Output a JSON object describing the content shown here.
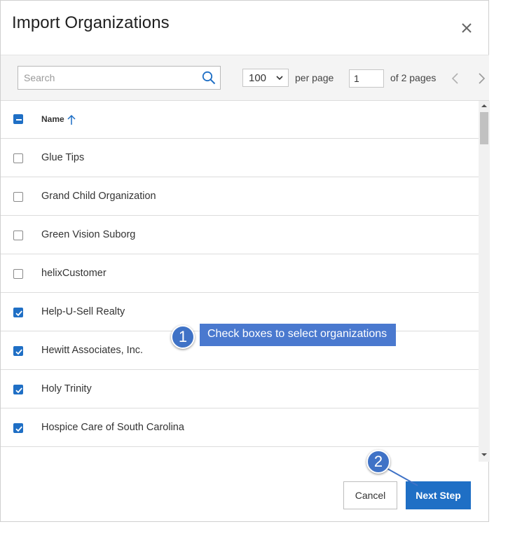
{
  "dialog": {
    "title": "Import Organizations"
  },
  "toolbar": {
    "search_placeholder": "Search",
    "per_page_value": "100",
    "per_page_label": "per page",
    "page_number": "1",
    "of_pages": "of 2 pages"
  },
  "table": {
    "header_name": "Name",
    "header_checkbox_state": "indeterminate",
    "rows": [
      {
        "name": "Glue Tips",
        "checked": false
      },
      {
        "name": "Grand Child Organization",
        "checked": false
      },
      {
        "name": "Green Vision Suborg",
        "checked": false
      },
      {
        "name": "helixCustomer",
        "checked": false
      },
      {
        "name": "Help-U-Sell Realty",
        "checked": true
      },
      {
        "name": "Hewitt Associates, Inc.",
        "checked": true
      },
      {
        "name": "Holy Trinity",
        "checked": true
      },
      {
        "name": "Hospice Care of South Carolina",
        "checked": true
      }
    ]
  },
  "footer": {
    "cancel_label": "Cancel",
    "next_label": "Next Step"
  },
  "callouts": {
    "one_number": "1",
    "one_text": "Check boxes to select organizations",
    "two_number": "2"
  },
  "colors": {
    "accent": "#1f6fc5",
    "callout": "#4a79cf"
  },
  "icons": [
    "close-icon",
    "search-icon",
    "chevron-down-icon",
    "chevron-left-icon",
    "chevron-right-icon",
    "arrow-up-icon",
    "checkmark-icon"
  ]
}
